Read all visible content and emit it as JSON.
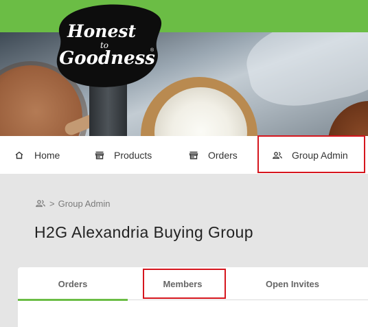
{
  "brand": {
    "logo_line1": "Honest",
    "logo_line2": "to",
    "logo_line3": "Goodness",
    "registered_mark": "®",
    "primary_color": "#6bbd45",
    "highlight_color": "#d5151d"
  },
  "nav": {
    "items": [
      {
        "label": "Home",
        "icon": "home-icon"
      },
      {
        "label": "Products",
        "icon": "store-icon"
      },
      {
        "label": "Orders",
        "icon": "store-icon"
      },
      {
        "label": "Group Admin",
        "icon": "group-icon"
      }
    ]
  },
  "breadcrumb": {
    "icon": "group-icon",
    "separator": ">",
    "label": "Group Admin"
  },
  "page": {
    "title": "H2G Alexandria Buying Group"
  },
  "tabs": [
    {
      "label": "Orders",
      "active": true
    },
    {
      "label": "Members",
      "active": false
    },
    {
      "label": "Open Invites",
      "active": false
    }
  ]
}
